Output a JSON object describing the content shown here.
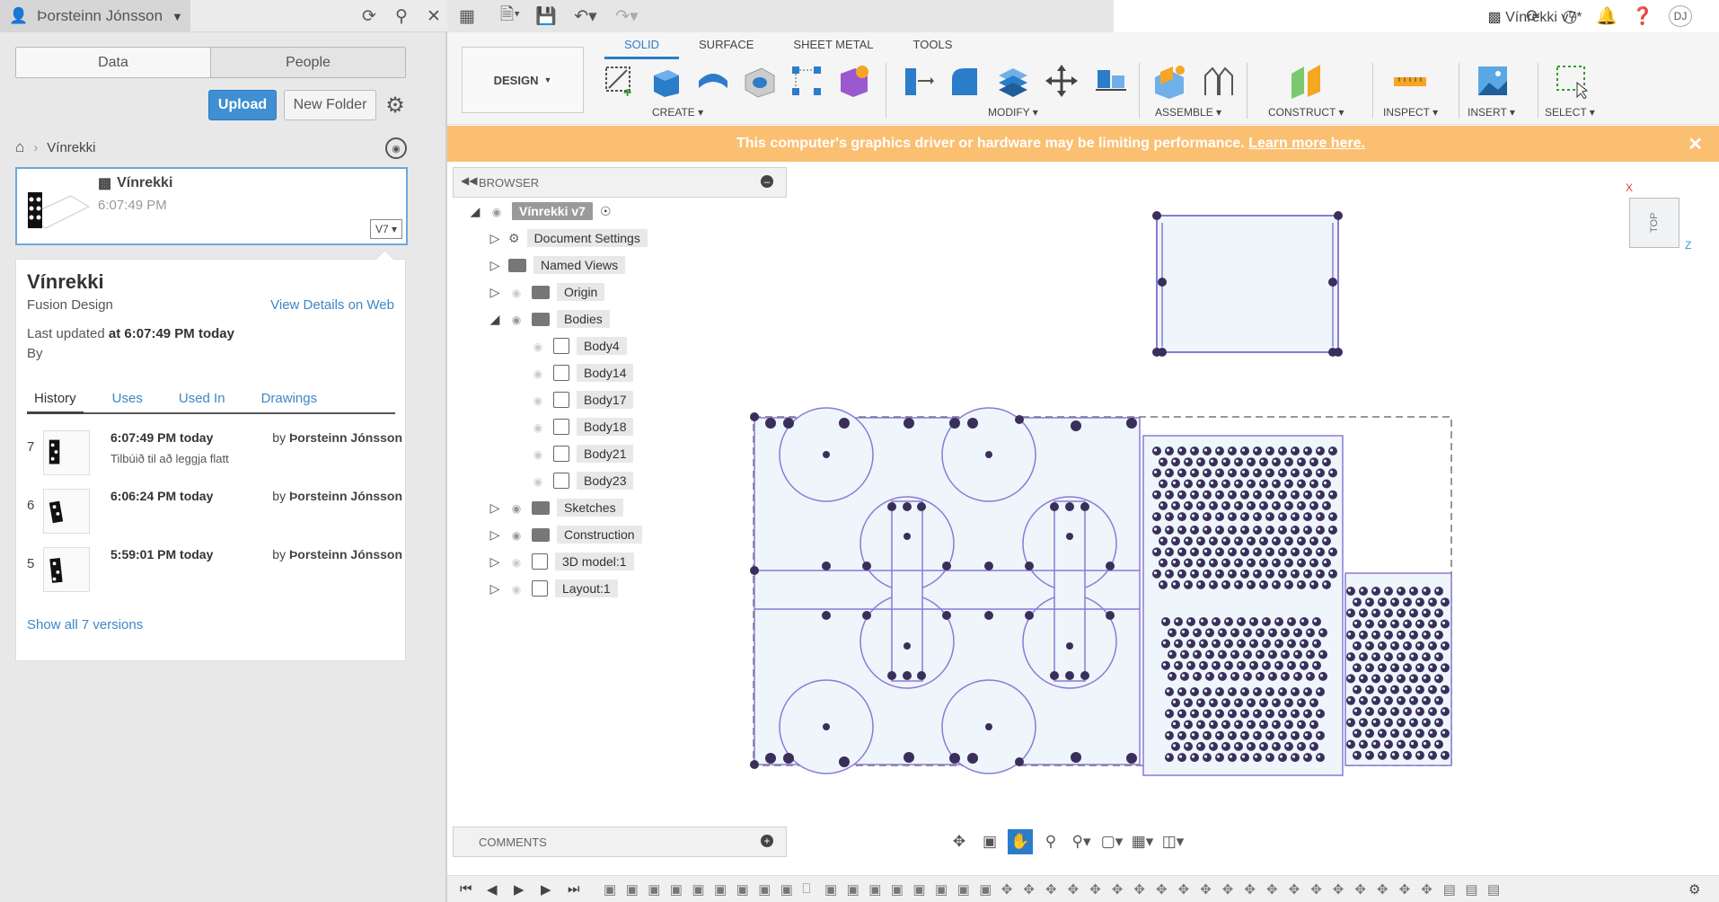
{
  "data_panel": {
    "user_name": "Þorsteinn Jónsson",
    "tabs": [
      {
        "label": "Data"
      },
      {
        "label": "People"
      }
    ],
    "upload_label": "Upload",
    "new_folder_label": "New Folder",
    "breadcrumb": {
      "current": "Vínrekki"
    },
    "file": {
      "name": "Vínrekki",
      "time": "6:07:49 PM",
      "version": "V7 ▾"
    },
    "details": {
      "title": "Vínrekki",
      "subtitle": "Fusion Design",
      "view_web": "View Details on Web",
      "updated_prefix": "Last updated",
      "updated_value": "at 6:07:49 PM today",
      "by": "By",
      "tabs": [
        {
          "label": "History"
        },
        {
          "label": "Uses"
        },
        {
          "label": "Used In"
        },
        {
          "label": "Drawings"
        }
      ],
      "history": [
        {
          "num": "7",
          "time": "6:07:49 PM today",
          "by": "by",
          "author": "Þorsteinn Jónsson",
          "desc": "Tilbúið til að leggja flatt"
        },
        {
          "num": "6",
          "time": "6:06:24 PM today",
          "by": "by",
          "author": "Þorsteinn Jónsson",
          "desc": ""
        },
        {
          "num": "5",
          "time": "5:59:01 PM today",
          "by": "by",
          "author": "Þorsteinn Jónsson",
          "desc": ""
        }
      ],
      "show_all": "Show all 7 versions"
    }
  },
  "document": {
    "title": "Vínrekki v7*"
  },
  "toolbar": {
    "workspace": "DESIGN",
    "tabs": [
      {
        "label": "SOLID"
      },
      {
        "label": "SURFACE"
      },
      {
        "label": "SHEET METAL"
      },
      {
        "label": "TOOLS"
      }
    ],
    "groups": {
      "create": "CREATE ▾",
      "modify": "MODIFY ▾",
      "assemble": "ASSEMBLE ▾",
      "construct": "CONSTRUCT ▾",
      "inspect": "INSPECT ▾",
      "insert": "INSERT ▾",
      "select": "SELECT ▾"
    }
  },
  "banner": {
    "text": "This computer's graphics driver or hardware may be limiting performance.",
    "link": "Learn more here."
  },
  "browser": {
    "title": "BROWSER",
    "root": "Vínrekki v7",
    "items": [
      {
        "label": "Document Settings"
      },
      {
        "label": "Named Views"
      },
      {
        "label": "Origin"
      },
      {
        "label": "Bodies"
      },
      {
        "label": "Body4"
      },
      {
        "label": "Body14"
      },
      {
        "label": "Body17"
      },
      {
        "label": "Body18"
      },
      {
        "label": "Body21"
      },
      {
        "label": "Body23"
      },
      {
        "label": "Sketches"
      },
      {
        "label": "Construction"
      },
      {
        "label": "3D model:1"
      },
      {
        "label": "Layout:1"
      }
    ]
  },
  "comments": {
    "title": "COMMENTS"
  },
  "viewcube": {
    "face": "TOP",
    "axis_x": "X",
    "axis_z": "Z"
  },
  "colors": {
    "accent": "#2b7cc9",
    "banner": "#fbbf71",
    "sketch_fill": "#eef5fb",
    "sketch_line": "#8a7ad6",
    "point": "#3a2f5a"
  }
}
